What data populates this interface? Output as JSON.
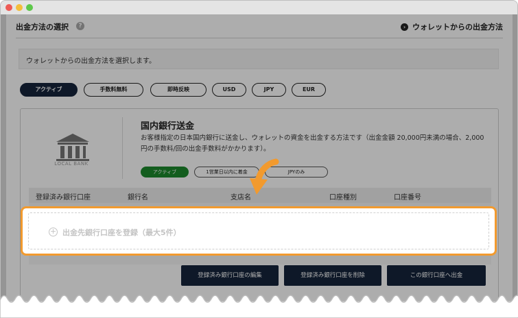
{
  "header": {
    "title": "出金方法の選択",
    "help_icon": "?",
    "wallet_link": "ウォレットからの出金方法"
  },
  "description": "ウォレットからの出金方法を選択します。",
  "filter_tabs": [
    {
      "label": "アクティブ",
      "active": true
    },
    {
      "label": "手数料無料",
      "active": false
    },
    {
      "label": "即時反映",
      "active": false
    },
    {
      "label": "USD",
      "active": false
    },
    {
      "label": "JPY",
      "active": false
    },
    {
      "label": "EUR",
      "active": false
    }
  ],
  "method": {
    "icon_label": "LOCAL BANK",
    "title": "国内銀行送金",
    "description": "お客様指定の日本国内銀行に送金し、ウォレットの資金を出金する方法です（出金金額 20,000円未満の場合、2,000円の手数料/回の出金手数料がかかります）。",
    "badges": [
      {
        "label": "アクティブ",
        "active": true
      },
      {
        "label": "1営業日以内に着金",
        "active": false
      },
      {
        "label": "JPYのみ",
        "active": false
      }
    ]
  },
  "table": {
    "columns": [
      "登録済み銀行口座",
      "銀行名",
      "支店名",
      "口座種別",
      "口座番号"
    ]
  },
  "add_account": {
    "icon": "⊕",
    "label": "出金先銀行口座を登録（最大5件）"
  },
  "actions": {
    "edit": "登録済み銀行口座の編集",
    "delete": "登録済み銀行口座を削除",
    "withdraw": "この銀行口座へ出金"
  },
  "colors": {
    "accent": "#f29a2e",
    "navy": "#15243b",
    "green": "#1d8a2d"
  }
}
